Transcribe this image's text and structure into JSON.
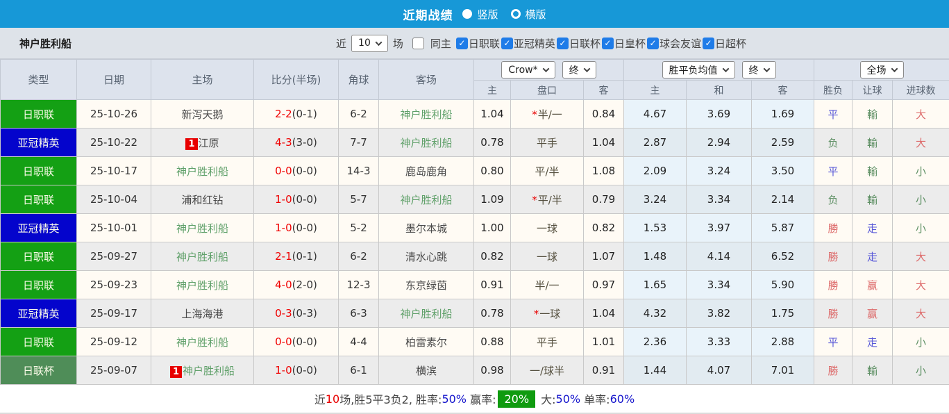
{
  "colors": {
    "titlebar_blue": "#1798d7",
    "jleague_green": "#14a014",
    "acl_blue": "#0404cc",
    "levain_green": "#4f8d58",
    "win_red": "#dd6a6a",
    "draw_blue": "#5858d8",
    "lose_green": "#5d8f63",
    "footer_badge_green": "#0f9b0f"
  },
  "titlebar": {
    "title": "近期战绩",
    "view_options": [
      {
        "label": "竖版",
        "selected": true
      },
      {
        "label": "横版",
        "selected": false
      }
    ]
  },
  "filterbar": {
    "team_name": "神户胜利船",
    "recent_label": "近",
    "recent_count": "10",
    "unit_label": "场",
    "same_venue": {
      "label": "同主",
      "checked": false
    },
    "competitions": [
      {
        "label": "日职联",
        "checked": true
      },
      {
        "label": "亚冠精英",
        "checked": true
      },
      {
        "label": "日联杯",
        "checked": true
      },
      {
        "label": "日皇杯",
        "checked": true
      },
      {
        "label": "球会友谊",
        "checked": true
      },
      {
        "label": "日超杯",
        "checked": true
      }
    ]
  },
  "table": {
    "main_headers": [
      "类型",
      "日期",
      "主场",
      "比分(半场)",
      "角球",
      "客场"
    ],
    "asian_odds_company": "Crow*",
    "asian_odds_time": "终",
    "euro_odds_label": "胜平负均值",
    "euro_odds_time": "终",
    "scope_label": "全场",
    "sub_headers": [
      "主",
      "盘口",
      "客",
      "主",
      "和",
      "客",
      "胜负",
      "让球",
      "进球数"
    ],
    "rows": [
      {
        "type": "日职联",
        "type_style": "jleague",
        "date": "25-10-26",
        "home": {
          "name": "新泻天鹅",
          "self": false,
          "badge": ""
        },
        "score": "2-2",
        "half_score": "(0-1)",
        "corners": "6-2",
        "away": {
          "name": "神户胜利船",
          "self": true,
          "badge": ""
        },
        "asian": {
          "home": "1.04",
          "star": true,
          "line": "半/一",
          "away": "0.84"
        },
        "euro": {
          "home": "4.67",
          "draw": "3.69",
          "away": "1.69"
        },
        "result": {
          "text": "平",
          "color": "blue"
        },
        "handicap_result": {
          "text": "輸",
          "color": "green"
        },
        "goals": {
          "text": "大",
          "color": "red"
        }
      },
      {
        "type": "亚冠精英",
        "type_style": "acl",
        "date": "25-10-22",
        "home": {
          "name": "江原",
          "self": false,
          "badge": "1"
        },
        "score": "4-3",
        "half_score": "(3-0)",
        "corners": "7-7",
        "away": {
          "name": "神户胜利船",
          "self": true,
          "badge": ""
        },
        "asian": {
          "home": "0.78",
          "star": false,
          "line": "平手",
          "away": "1.04"
        },
        "euro": {
          "home": "2.87",
          "draw": "2.94",
          "away": "2.59"
        },
        "result": {
          "text": "负",
          "color": "green"
        },
        "handicap_result": {
          "text": "輸",
          "color": "green"
        },
        "goals": {
          "text": "大",
          "color": "red"
        }
      },
      {
        "type": "日职联",
        "type_style": "jleague",
        "date": "25-10-17",
        "home": {
          "name": "神户胜利船",
          "self": true,
          "badge": ""
        },
        "score": "0-0",
        "half_score": "(0-0)",
        "corners": "14-3",
        "away": {
          "name": "鹿岛鹿角",
          "self": false,
          "badge": ""
        },
        "asian": {
          "home": "0.80",
          "star": false,
          "line": "平/半",
          "away": "1.08"
        },
        "euro": {
          "home": "2.09",
          "draw": "3.24",
          "away": "3.50"
        },
        "result": {
          "text": "平",
          "color": "blue"
        },
        "handicap_result": {
          "text": "輸",
          "color": "green"
        },
        "goals": {
          "text": "小",
          "color": "green"
        }
      },
      {
        "type": "日职联",
        "type_style": "jleague",
        "date": "25-10-04",
        "home": {
          "name": "浦和红钻",
          "self": false,
          "badge": ""
        },
        "score": "1-0",
        "half_score": "(0-0)",
        "corners": "5-7",
        "away": {
          "name": "神户胜利船",
          "self": true,
          "badge": ""
        },
        "asian": {
          "home": "1.09",
          "star": true,
          "line": "平/半",
          "away": "0.79"
        },
        "euro": {
          "home": "3.24",
          "draw": "3.34",
          "away": "2.14"
        },
        "result": {
          "text": "负",
          "color": "green"
        },
        "handicap_result": {
          "text": "輸",
          "color": "green"
        },
        "goals": {
          "text": "小",
          "color": "green"
        }
      },
      {
        "type": "亚冠精英",
        "type_style": "acl",
        "date": "25-10-01",
        "home": {
          "name": "神户胜利船",
          "self": true,
          "badge": ""
        },
        "score": "1-0",
        "half_score": "(0-0)",
        "corners": "5-2",
        "away": {
          "name": "墨尔本城",
          "self": false,
          "badge": ""
        },
        "asian": {
          "home": "1.00",
          "star": false,
          "line": "一球",
          "away": "0.82"
        },
        "euro": {
          "home": "1.53",
          "draw": "3.97",
          "away": "5.87"
        },
        "result": {
          "text": "勝",
          "color": "red"
        },
        "handicap_result": {
          "text": "走",
          "color": "blue"
        },
        "goals": {
          "text": "小",
          "color": "green"
        }
      },
      {
        "type": "日职联",
        "type_style": "jleague",
        "date": "25-09-27",
        "home": {
          "name": "神户胜利船",
          "self": true,
          "badge": ""
        },
        "score": "2-1",
        "half_score": "(0-1)",
        "corners": "6-2",
        "away": {
          "name": "清水心跳",
          "self": false,
          "badge": ""
        },
        "asian": {
          "home": "0.82",
          "star": false,
          "line": "一球",
          "away": "1.07"
        },
        "euro": {
          "home": "1.48",
          "draw": "4.14",
          "away": "6.52"
        },
        "result": {
          "text": "勝",
          "color": "red"
        },
        "handicap_result": {
          "text": "走",
          "color": "blue"
        },
        "goals": {
          "text": "大",
          "color": "red"
        }
      },
      {
        "type": "日职联",
        "type_style": "jleague",
        "date": "25-09-23",
        "home": {
          "name": "神户胜利船",
          "self": true,
          "badge": ""
        },
        "score": "4-0",
        "half_score": "(2-0)",
        "corners": "12-3",
        "away": {
          "name": "东京绿茵",
          "self": false,
          "badge": ""
        },
        "asian": {
          "home": "0.91",
          "star": false,
          "line": "半/一",
          "away": "0.97"
        },
        "euro": {
          "home": "1.65",
          "draw": "3.34",
          "away": "5.90"
        },
        "result": {
          "text": "勝",
          "color": "red"
        },
        "handicap_result": {
          "text": "赢",
          "color": "red"
        },
        "goals": {
          "text": "大",
          "color": "red"
        }
      },
      {
        "type": "亚冠精英",
        "type_style": "acl",
        "date": "25-09-17",
        "home": {
          "name": "上海海港",
          "self": false,
          "badge": ""
        },
        "score": "0-3",
        "half_score": "(0-3)",
        "corners": "6-3",
        "away": {
          "name": "神户胜利船",
          "self": true,
          "badge": ""
        },
        "asian": {
          "home": "0.78",
          "star": true,
          "line": "一球",
          "away": "1.04"
        },
        "euro": {
          "home": "4.32",
          "draw": "3.82",
          "away": "1.75"
        },
        "result": {
          "text": "勝",
          "color": "red"
        },
        "handicap_result": {
          "text": "赢",
          "color": "red"
        },
        "goals": {
          "text": "大",
          "color": "red"
        }
      },
      {
        "type": "日职联",
        "type_style": "jleague",
        "date": "25-09-12",
        "home": {
          "name": "神户胜利船",
          "self": true,
          "badge": ""
        },
        "score": "0-0",
        "half_score": "(0-0)",
        "corners": "4-4",
        "away": {
          "name": "柏雷素尔",
          "self": false,
          "badge": ""
        },
        "asian": {
          "home": "0.88",
          "star": false,
          "line": "平手",
          "away": "1.01"
        },
        "euro": {
          "home": "2.36",
          "draw": "3.33",
          "away": "2.88"
        },
        "result": {
          "text": "平",
          "color": "blue"
        },
        "handicap_result": {
          "text": "走",
          "color": "blue"
        },
        "goals": {
          "text": "小",
          "color": "green"
        }
      },
      {
        "type": "日联杯",
        "type_style": "levain",
        "date": "25-09-07",
        "home": {
          "name": "神户胜利船",
          "self": true,
          "badge": "1"
        },
        "score": "1-0",
        "half_score": "(0-0)",
        "corners": "6-1",
        "away": {
          "name": "横滨",
          "self": false,
          "badge": ""
        },
        "asian": {
          "home": "0.98",
          "star": false,
          "line": "一/球半",
          "away": "0.91"
        },
        "euro": {
          "home": "1.44",
          "draw": "4.07",
          "away": "7.01"
        },
        "result": {
          "text": "勝",
          "color": "red"
        },
        "handicap_result": {
          "text": "輸",
          "color": "green"
        },
        "goals": {
          "text": "小",
          "color": "green"
        }
      }
    ]
  },
  "footer": {
    "segments": [
      {
        "text": "近",
        "style": "plain"
      },
      {
        "text": "10",
        "style": "red"
      },
      {
        "text": "场,胜5平3负2, 胜率:",
        "style": "plain"
      },
      {
        "text": "50%",
        "style": "blue"
      },
      {
        "text": " 赢率:",
        "style": "plain"
      },
      {
        "text": "20%",
        "style": "badge"
      },
      {
        "text": " 大:",
        "style": "plain"
      },
      {
        "text": "50%",
        "style": "blue"
      },
      {
        "text": " 单率:",
        "style": "plain"
      },
      {
        "text": "60%",
        "style": "blue"
      }
    ]
  }
}
